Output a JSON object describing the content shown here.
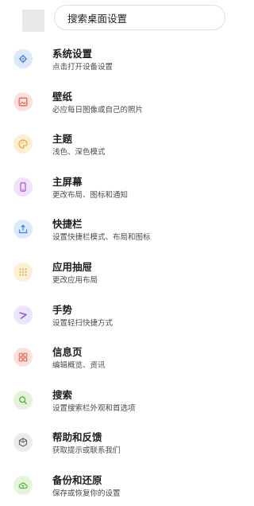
{
  "search": {
    "placeholder": "搜索桌面设置"
  },
  "items": [
    {
      "title": "系统设置",
      "subtitle": "点击打开设备设置",
      "icon": "gear-icon",
      "bg": "#dde9fb",
      "fg": "#4a7fe0"
    },
    {
      "title": "壁纸",
      "subtitle": "必应每日图像或自己的照片",
      "icon": "image-icon",
      "bg": "#fbe1de",
      "fg": "#e06a5a"
    },
    {
      "title": "主题",
      "subtitle": "浅色、深色模式",
      "icon": "palette-icon",
      "bg": "#fdf0d2",
      "fg": "#e6a72f"
    },
    {
      "title": "主屏幕",
      "subtitle": "更改布局、图标和通知",
      "icon": "phone-icon",
      "bg": "#f1e1fb",
      "fg": "#b05bdf"
    },
    {
      "title": "快捷栏",
      "subtitle": "设置快捷栏模式、布局和图标",
      "icon": "dock-icon",
      "bg": "#dcebfb",
      "fg": "#3a88e0"
    },
    {
      "title": "应用抽屉",
      "subtitle": "更改应用布局",
      "icon": "grid-dots-icon",
      "bg": "#fdf0d8",
      "fg": "#e6a72f"
    },
    {
      "title": "手势",
      "subtitle": "设置轻扫快捷方式",
      "icon": "gesture-icon",
      "bg": "#ece4fb",
      "fg": "#8a5ce0"
    },
    {
      "title": "信息页",
      "subtitle": "编辑概览、资讯",
      "icon": "feed-icon",
      "bg": "#fbe1de",
      "fg": "#e06a5a"
    },
    {
      "title": "搜索",
      "subtitle": "设置搜索栏外观和首选项",
      "icon": "search-icon",
      "bg": "#e4f4dc",
      "fg": "#5fb04a"
    },
    {
      "title": "帮助和反馈",
      "subtitle": "获取提示或联系我们",
      "icon": "help-icon",
      "bg": "#ececec",
      "fg": "#666666"
    },
    {
      "title": "备份和还原",
      "subtitle": "保存或恢复你的设置",
      "icon": "cloud-icon",
      "bg": "#e4f4dc",
      "fg": "#5fb04a"
    }
  ]
}
